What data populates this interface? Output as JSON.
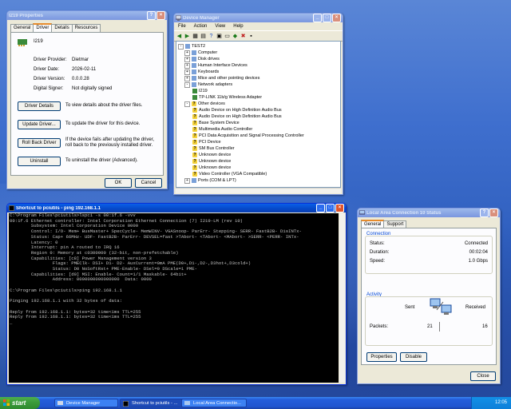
{
  "props": {
    "title": "I219 Properties",
    "tabs": [
      "General",
      "Driver",
      "Details",
      "Resources"
    ],
    "device_name": "I219",
    "fields": [
      {
        "label": "Driver Provider:",
        "value": "Dietmar"
      },
      {
        "label": "Driver Date:",
        "value": "2026-02-11"
      },
      {
        "label": "Driver Version:",
        "value": "0.0.0.28"
      },
      {
        "label": "Digital Signer:",
        "value": "Not digitally signed"
      }
    ],
    "actions": [
      {
        "button": "Driver Details",
        "desc": "To view details about the driver files."
      },
      {
        "button": "Update Driver...",
        "desc": "To update the driver for this device."
      },
      {
        "button": "Roll Back Driver",
        "desc": "If the device fails after updating the driver, roll back to the previously installed driver."
      },
      {
        "button": "Uninstall",
        "desc": "To uninstall the driver (Advanced)."
      }
    ],
    "ok": "OK",
    "cancel": "Cancel"
  },
  "devmgr": {
    "title": "Device Manager",
    "menu": [
      "File",
      "Action",
      "View",
      "Help"
    ],
    "root": "TEST2",
    "items": [
      {
        "text": "Computer",
        "level": 1,
        "exp": "+"
      },
      {
        "text": "Disk drives",
        "level": 1,
        "exp": "+"
      },
      {
        "text": "Human Interface Devices",
        "level": 1,
        "exp": "+"
      },
      {
        "text": "Keyboards",
        "level": 1,
        "exp": "+"
      },
      {
        "text": "Mice and other pointing devices",
        "level": 1,
        "exp": "+"
      },
      {
        "text": "Network adapters",
        "level": 1,
        "exp": "-"
      },
      {
        "text": "I219",
        "level": 2
      },
      {
        "text": "TP-LINK 11b/g Wireless Adapter",
        "level": 2
      },
      {
        "text": "Other devices",
        "level": 1,
        "exp": "-",
        "warn": true
      },
      {
        "text": "Audio Device on High Definition Audio Bus",
        "level": 2,
        "warn": true
      },
      {
        "text": "Audio Device on High Definition Audio Bus",
        "level": 2,
        "warn": true
      },
      {
        "text": "Base System Device",
        "level": 2,
        "warn": true
      },
      {
        "text": "Multimedia Audio Controller",
        "level": 2,
        "warn": true
      },
      {
        "text": "PCI Data Acquisition and Signal Processing Controller",
        "level": 2,
        "warn": true
      },
      {
        "text": "PCI Device",
        "level": 2,
        "warn": true
      },
      {
        "text": "SM Bus Controller",
        "level": 2,
        "warn": true
      },
      {
        "text": "Unknown device",
        "level": 2,
        "warn": true
      },
      {
        "text": "Unknown device",
        "level": 2,
        "warn": true
      },
      {
        "text": "Unknown device",
        "level": 2,
        "warn": true
      },
      {
        "text": "Video Controller (VGA Compatible)",
        "level": 2,
        "warn": true
      },
      {
        "text": "Ports (COM & LPT)",
        "level": 1,
        "exp": "+"
      }
    ]
  },
  "console": {
    "title": "Shortcut to pciutils - ping 192.168.1.1",
    "lines": [
      "C:\\Program Files\\pciutils>lspci -s 00:1f.6 -vvv",
      "00:1f.6 Ethernet controller: Intel Corporation Ethernet Connection (7) I219-LM (rev 10)",
      "        Subsystem: Intel Corporation Device 0000",
      "        Control: I/O- Mem+ BusMaster+ SpecCycle- MemWINV- VGASnoop- ParErr- Stepping- SERR- FastB2B- DisINTx-",
      "        Status: Cap+ 66MHz- UDF- FastB2B- ParErr- DEVSEL=fast >TAbort- <TAbort- <MAbort- >SERR- <PERR- INTx-",
      "        Latency: 0",
      "        Interrupt: pin A routed to IRQ 16",
      "        Region 0: Memory at c0300000 (32-bit, non-prefetchable)",
      "        Capabilities: [c8] Power Management version 3",
      "                Flags: PMEClk- DSI+ D1- D2- AuxCurrent=0mA PME(D0+,D1-,D2-,D3hot+,D3cold+)",
      "                Status: D0 NoSoftRst+ PME-Enable- DSel=0 DScale=1 PME-",
      "        Capabilities: [d0] MSI: Enable- Count=1/1 Maskable- 64bit+",
      "                Address: 0000000000000000  Data: 0000",
      "",
      "C:\\Program Files\\pciutils>ping 192.168.1.1",
      "",
      "Pinging 192.168.1.1 with 32 bytes of data:",
      "",
      "Reply from 192.168.1.1: bytes=32 time<1ms TTL=255",
      "Reply from 192.168.1.1: bytes=32 time<1ms TTL=255",
      "_"
    ]
  },
  "status": {
    "title": "Local Area Connection 10 Status",
    "tabs": [
      "General",
      "Support"
    ],
    "connection_group": "Connection",
    "rows": [
      {
        "label": "Status:",
        "value": "Connected"
      },
      {
        "label": "Duration:",
        "value": "00:02:04"
      },
      {
        "label": "Speed:",
        "value": "1.0 Gbps"
      }
    ],
    "activity_group": "Activity",
    "sent_label": "Sent",
    "received_label": "Received",
    "packets_label": "Packets:",
    "packets_sent": "21",
    "packets_received": "16",
    "properties": "Properties",
    "disable": "Disable",
    "close": "Close"
  },
  "taskbar": {
    "start": "start",
    "tasks": [
      "Device Manager",
      "Shortcut to pciutils - ...",
      "Local Area Connectio..."
    ],
    "clock": "12:05"
  },
  "colors": {
    "titlebar_active": "#0a5fe8",
    "titlebar_inactive": "#7a96df",
    "desktop": "#3f6fce",
    "taskbar": "#245edb",
    "start_green": "#3c9c3c"
  }
}
